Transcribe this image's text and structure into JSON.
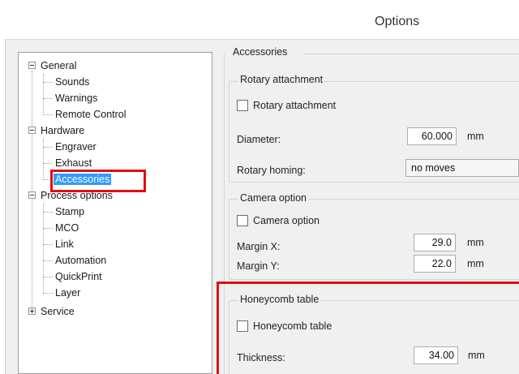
{
  "window": {
    "title": "Options"
  },
  "tree": {
    "items": [
      {
        "label": "General",
        "expander": "minus"
      },
      {
        "label": "Sounds"
      },
      {
        "label": "Warnings"
      },
      {
        "label": "Remote Control"
      },
      {
        "label": "Hardware",
        "expander": "minus"
      },
      {
        "label": "Engraver"
      },
      {
        "label": "Exhaust"
      },
      {
        "label": "Accessories",
        "selected": true
      },
      {
        "label": "Process options",
        "expander": "minus"
      },
      {
        "label": "Stamp"
      },
      {
        "label": "MCO"
      },
      {
        "label": "Link"
      },
      {
        "label": "Automation"
      },
      {
        "label": "QuickPrint"
      },
      {
        "label": "Layer"
      },
      {
        "label": "Service",
        "expander": "plus"
      }
    ],
    "highlight_color": "#e01010",
    "selection_color": "#3399ff"
  },
  "panel": {
    "title": "Accessories",
    "rotary": {
      "group_label": "Rotary attachment",
      "checkbox_label": "Rotary attachment",
      "checked": false,
      "diameter_label": "Diameter:",
      "diameter_value": "60.000",
      "diameter_unit": "mm",
      "homing_label": "Rotary homing:",
      "homing_value": "no moves"
    },
    "camera": {
      "group_label": "Camera option",
      "checkbox_label": "Camera option",
      "checked": false,
      "margin_x_label": "Margin X:",
      "margin_x_value": "29.0",
      "margin_x_unit": "mm",
      "margin_y_label": "Margin Y:",
      "margin_y_value": "22.0",
      "margin_y_unit": "mm"
    },
    "honeycomb": {
      "group_label": "Honeycomb table",
      "checkbox_label": "Honeycomb table",
      "checked": false,
      "thickness_label": "Thickness:",
      "thickness_value": "34.00",
      "thickness_unit": "mm"
    }
  }
}
